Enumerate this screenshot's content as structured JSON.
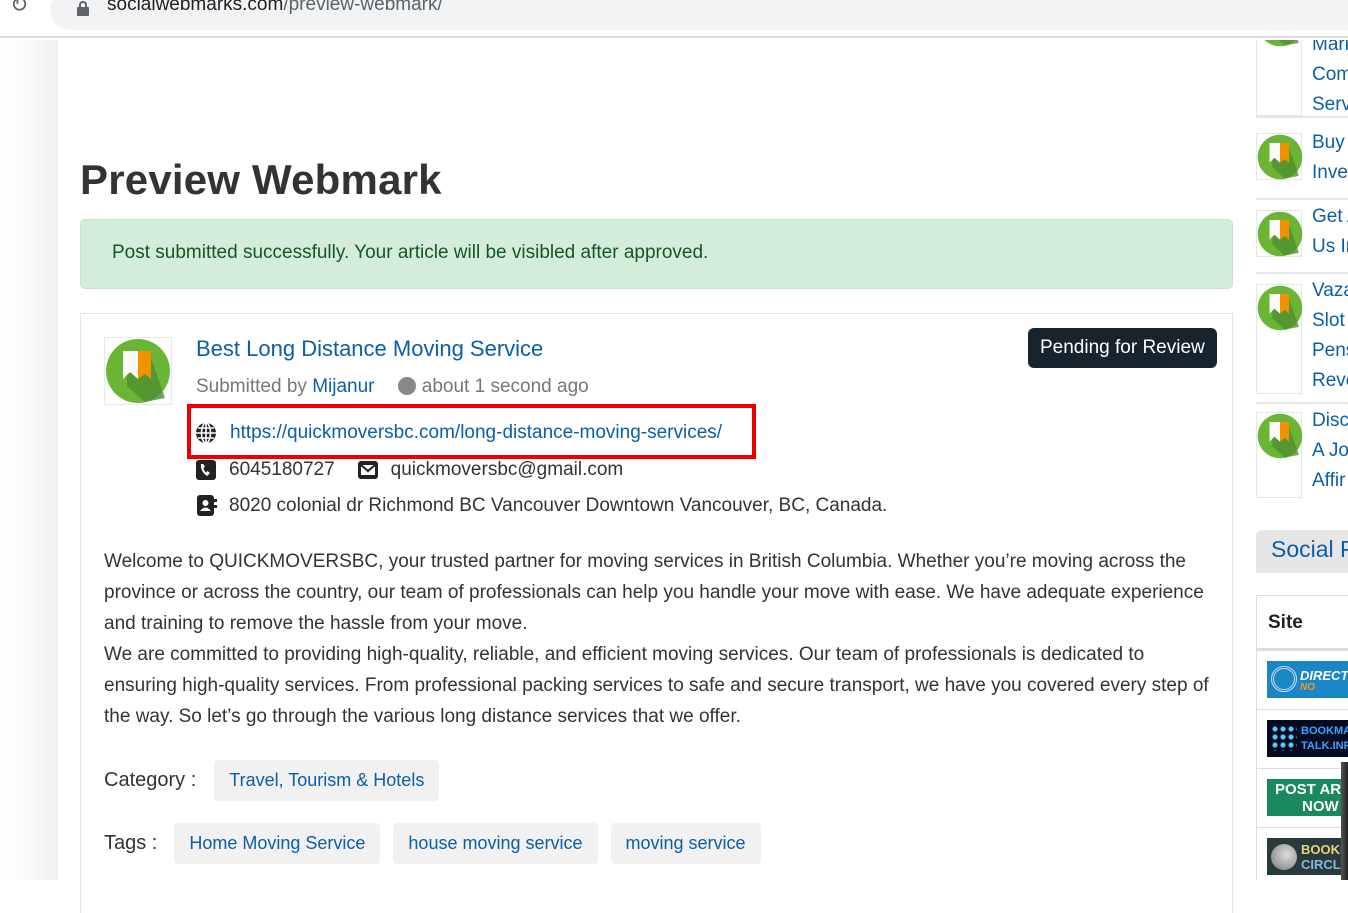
{
  "browser": {
    "url_host": "socialwebmarks.com",
    "url_path": "/preview-webmark/",
    "reload_icon": "reload-icon",
    "lock_icon": "lock-icon"
  },
  "page": {
    "title": "Preview Webmark",
    "alert": "Post submitted successfully. Your article will be visibled after approved."
  },
  "post": {
    "title": "Best Long Distance Moving Service",
    "submitted_by_label": "Submitted by",
    "author": "Mijanur",
    "time": "about 1 second ago",
    "status": "Pending for Review",
    "url": "https://quickmoversbc.com/long-distance-moving-services/",
    "phone": "6045180727",
    "email": "quickmoversbc@gmail.com",
    "address": "8020 colonial dr Richmond BC Vancouver Downtown Vancouver, BC, Canada.",
    "description_lines": [
      "Welcome to QUICKMOVERSBC, your trusted partner for moving services in British Columbia. Whether you’re moving across the province or across the country, our team of professionals can help you handle your move with ease. We have adequate experience and training to remove the hassle from your move.",
      "We are committed to providing high-quality, reliable, and efficient moving services. Our team of professionals is dedicated to ensuring high-quality services. From professional packing services to safe and secure transport, we have you covered every step of the way. So let’s go through the various long distance services that we offer."
    ],
    "category_label": "Category :",
    "category": "Travel, Tourism & Hotels",
    "tags_label": "Tags :",
    "tags": [
      "Home Moving Service",
      "house moving service",
      "moving service"
    ]
  },
  "sidebar": {
    "recent_items": [
      {
        "lines": [
          "Mark",
          "Com",
          "Serv"
        ]
      },
      {
        "lines": [
          "Buy",
          "Inve"
        ]
      },
      {
        "lines": [
          "Get A",
          "Us In"
        ]
      },
      {
        "lines": [
          "Vaza",
          "Slot",
          "Pens",
          "Reve"
        ]
      },
      {
        "lines": [
          "Disc",
          "A Jo",
          "Affir"
        ]
      }
    ],
    "social_heading": "Social P",
    "site_table_header": "Site",
    "sites": [
      {
        "name": "DIRECTORY NOW",
        "line1": "DIRECTO",
        "line2": "NO"
      },
      {
        "name": "BOOKMARK TALK",
        "line1": "BOOKMA",
        "line2": "TALK.INF"
      },
      {
        "name": "POST ARTICLE NOW",
        "line1": "POST ART",
        "line2": "NOW"
      },
      {
        "name": "BOOKMARK CIRCLE",
        "line1": "BOOKM",
        "line2": "CIRCLE"
      }
    ]
  },
  "colors": {
    "link": "#0b5ea8",
    "alert_bg": "#d4edda",
    "alert_text": "#155724",
    "badge_bg": "#17242e",
    "highlight_box": "#ee0000",
    "logo_green": "#6ab535",
    "logo_orange": "#f39200"
  }
}
